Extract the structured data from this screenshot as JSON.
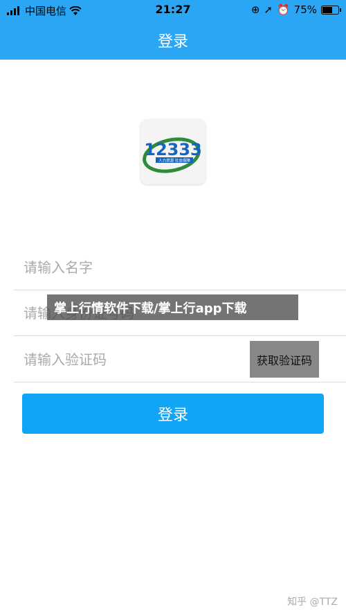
{
  "status_bar": {
    "carrier": "中国电信",
    "time": "21:27",
    "battery": "75%",
    "battery_level": 0.75
  },
  "navbar": {
    "title": "登录"
  },
  "logo": {
    "text": "12333",
    "subtext": "人力资源 社会保障",
    "icon": "12333-logo"
  },
  "form": {
    "name_placeholder": "请输入名字",
    "id_placeholder": "请输入身份证号码",
    "code_placeholder": "请输入验证码",
    "get_code_label": "获取验证码",
    "login_label": "登录"
  },
  "overlay_caption": "掌上行情软件下载/掌上行app下载",
  "watermark": "知乎 @TTZ",
  "colors": {
    "primary": "#2aa6f5",
    "button": "#11a5f5"
  }
}
